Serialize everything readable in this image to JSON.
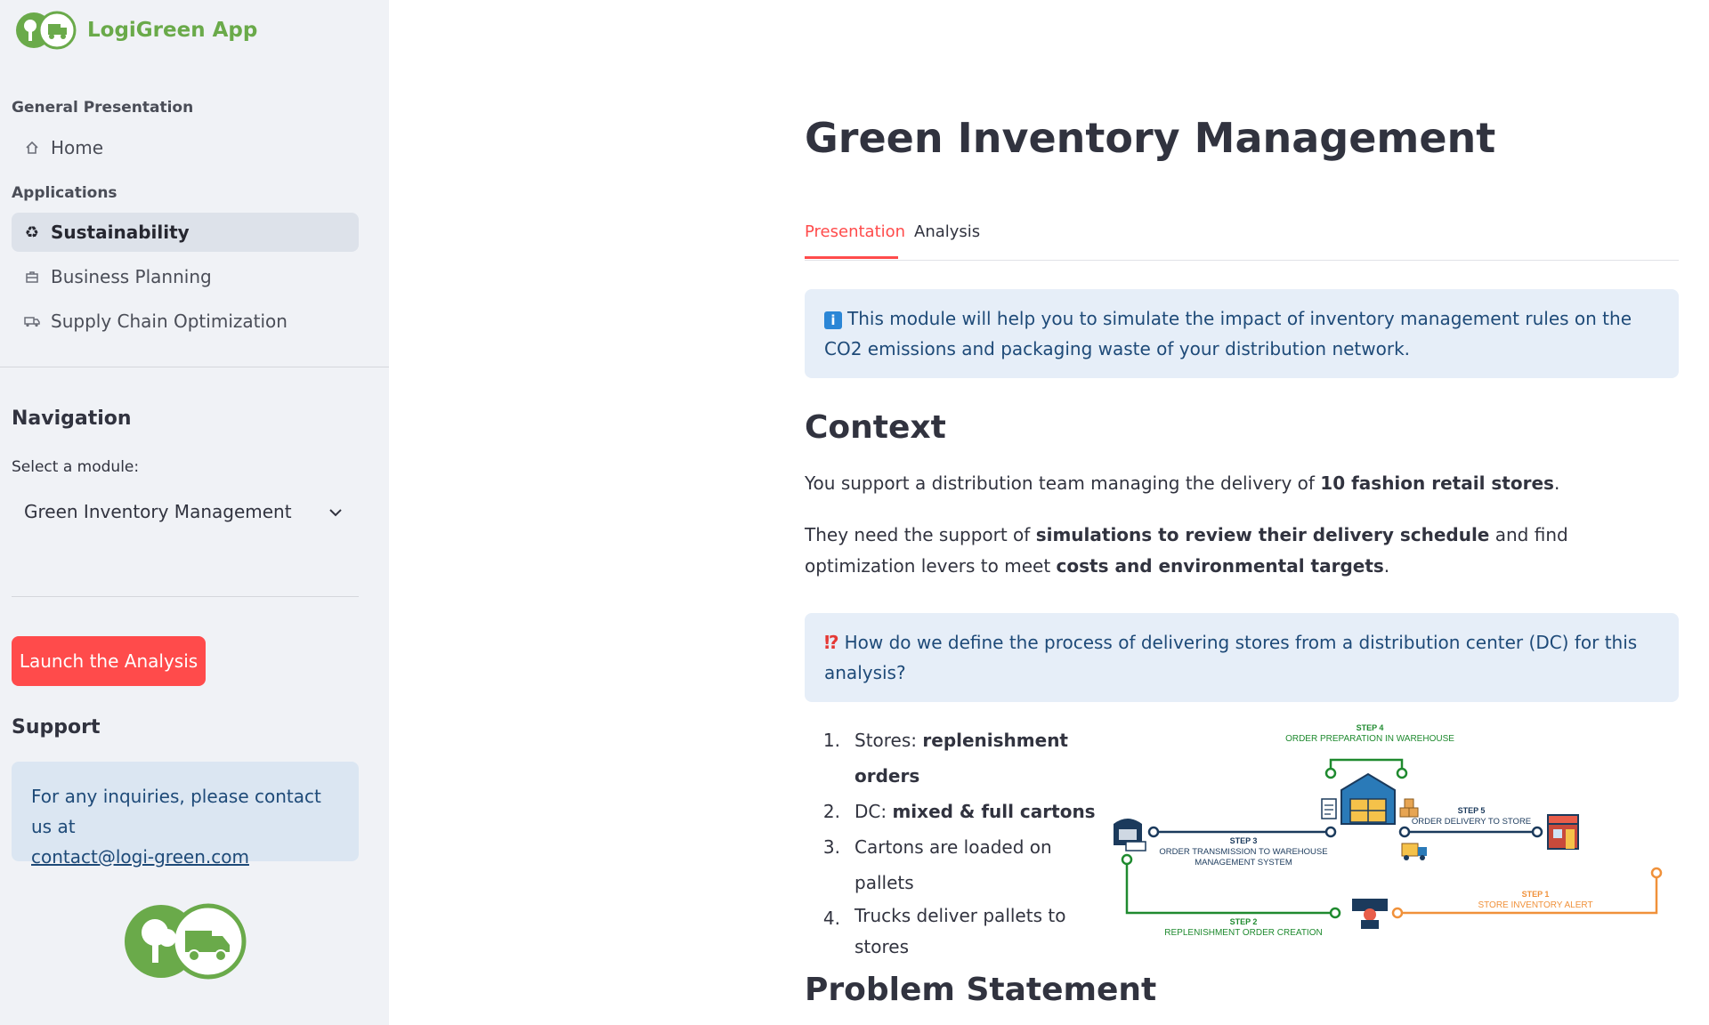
{
  "app": {
    "name": "LogiGreen App"
  },
  "sidebar": {
    "sections": [
      {
        "label": "General Presentation",
        "items": [
          {
            "label": "Home",
            "icon": "home-icon"
          }
        ]
      },
      {
        "label": "Applications",
        "items": [
          {
            "label": "Sustainability",
            "icon": "recycle-icon",
            "active": true
          },
          {
            "label": "Business Planning",
            "icon": "briefcase-icon"
          },
          {
            "label": "Supply Chain Optimization",
            "icon": "truck-icon"
          }
        ]
      }
    ],
    "navigation": {
      "heading": "Navigation",
      "select_label": "Select a module:",
      "selected_value": "Green Inventory Management"
    },
    "launch_button": "Launch the Analysis",
    "support": {
      "heading": "Support",
      "text": "For any inquiries, please contact us at",
      "email": "contact@logi-green.com"
    }
  },
  "main": {
    "title": "Green Inventory Management",
    "tabs": [
      {
        "label": "Presentation",
        "active": true
      },
      {
        "label": "Analysis",
        "active": false
      }
    ],
    "info_text": "This module will help you to simulate the impact of inventory management rules on the CO2 emissions and packaging waste of your distribution network.",
    "context_heading": "Context",
    "context_p1": {
      "pre": "You support a distribution team managing the delivery of ",
      "bold": "10 fashion retail stores",
      "post": "."
    },
    "context_p2": {
      "pre": "They need the support of ",
      "bold1": "simulations to review their delivery schedule",
      "mid": " and find optimization levers to meet ",
      "bold2": "costs and environmental targets",
      "post": "."
    },
    "question_text": "How do we define the process of delivering stores from a distribution center (DC) for this analysis?",
    "steps": [
      {
        "num": "1.",
        "pre": "Stores: ",
        "bold": "replenishment orders"
      },
      {
        "num": "2.",
        "pre": "DC: ",
        "bold": "mixed & full cartons"
      },
      {
        "num": "3.",
        "pre": "Cartons are loaded on pallets",
        "bold": ""
      },
      {
        "num": "4.",
        "pre": "Trucks deliver pallets to stores",
        "bold": ""
      }
    ],
    "diagram": {
      "step4": {
        "num": "STEP 4",
        "text": "ORDER PREPARATION IN WAREHOUSE"
      },
      "step3": {
        "num": "STEP 3",
        "text1": "ORDER TRANSMISSION TO WAREHOUSE",
        "text2": "MANAGEMENT SYSTEM"
      },
      "step5": {
        "num": "STEP 5",
        "text": "ORDER DELIVERY TO STORE"
      },
      "step2": {
        "num": "STEP 2",
        "text": "REPLENISHMENT ORDER CREATION"
      },
      "step1": {
        "num": "STEP 1",
        "text": "STORE INVENTORY ALERT"
      }
    },
    "problem_heading": "Problem Statement"
  },
  "colors": {
    "accent": "#ff4b4b",
    "brand_green": "#6aaa4a",
    "info_bg": "#e6eef8",
    "info_text": "#1e4a78"
  }
}
